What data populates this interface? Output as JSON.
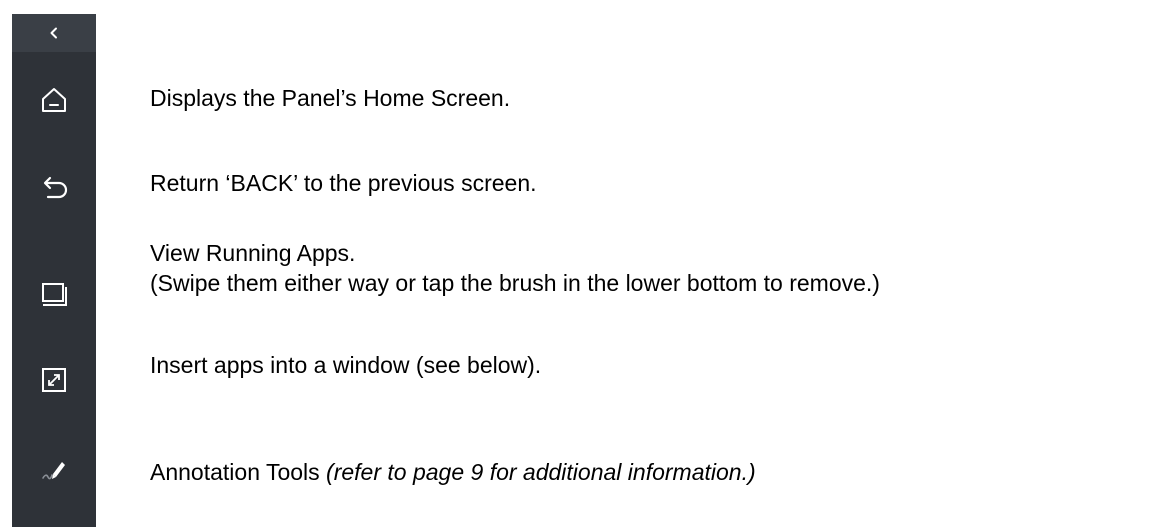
{
  "sidebar": {
    "collapse_icon": "chevron-left-icon",
    "buttons": [
      {
        "icon": "home-icon"
      },
      {
        "icon": "back-arrow-icon"
      },
      {
        "icon": "recent-apps-icon"
      },
      {
        "icon": "window-resize-icon"
      },
      {
        "icon": "pen-annotation-icon"
      }
    ]
  },
  "descriptions": {
    "home": "Displays the Panel’s Home Screen.",
    "back": "Return ‘BACK’ to the previous screen.",
    "recent_line1": "View Running Apps.",
    "recent_line2": "(Swipe them either way or tap the brush in the lower bottom to remove.)",
    "window": "Insert apps into a window (see below).",
    "annotation_main": "Annotation Tools ",
    "annotation_note": "(refer to page 9 for additional information.)"
  },
  "colors": {
    "sidebar_bg": "#2e3238",
    "sidebar_top_bg": "#3a3f46",
    "icon": "#ffffff",
    "text": "#000000"
  }
}
